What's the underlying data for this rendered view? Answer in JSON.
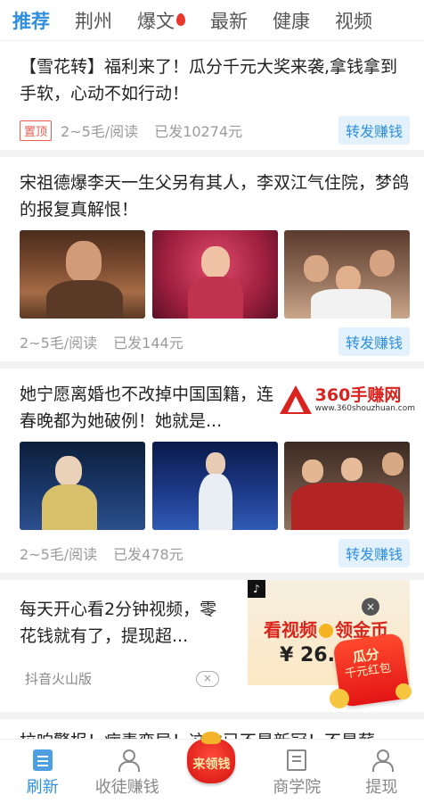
{
  "tabs": [
    {
      "label": "推荐",
      "active": true
    },
    {
      "label": "荆州"
    },
    {
      "label": "爆文",
      "hot": true
    },
    {
      "label": "最新"
    },
    {
      "label": "健康"
    },
    {
      "label": "视频"
    }
  ],
  "articles": [
    {
      "title": "【雪花转】福利来了！瓜分千元大奖来袭,拿钱拿到手软，心动不如行动！",
      "pin": "置顶",
      "rate": "2~5毛/阅读",
      "sent": "已发10274元",
      "share": "转发赚钱"
    },
    {
      "title": "宋祖德爆李天一生父另有其人，李双江气住院，梦鸽的报复真解恨！",
      "rate": "2~5毛/阅读",
      "sent": "已发144元",
      "share": "转发赚钱"
    },
    {
      "title": "她宁愿离婚也不改掉中国国籍，连春晚都为她破例！她就是...",
      "rate": "2~5毛/阅读",
      "sent": "已发478元",
      "share": "转发赚钱"
    }
  ],
  "watermark": {
    "title": "360手赚网",
    "url": "www.360shouzhuan.com"
  },
  "ad": {
    "text": "每天开心看2分钟视频，零花钱就有了，提现超...",
    "source": "抖音火山版",
    "close": "×",
    "banner_tiktok": "♪",
    "banner_close": "×",
    "banner_head_left": "看视频",
    "banner_head_right": "领金币",
    "amount": "¥ 26.",
    "redpack_main": "瓜分",
    "redpack_sub": "千元红包"
  },
  "last_title": "拉响警报！病毒变异！这次已不是新冠！不是薪",
  "bottom_nav": {
    "refresh": "刷新",
    "recruit": "收徒赚钱",
    "center": "来领钱",
    "school": "商学院",
    "withdraw": "提现"
  }
}
